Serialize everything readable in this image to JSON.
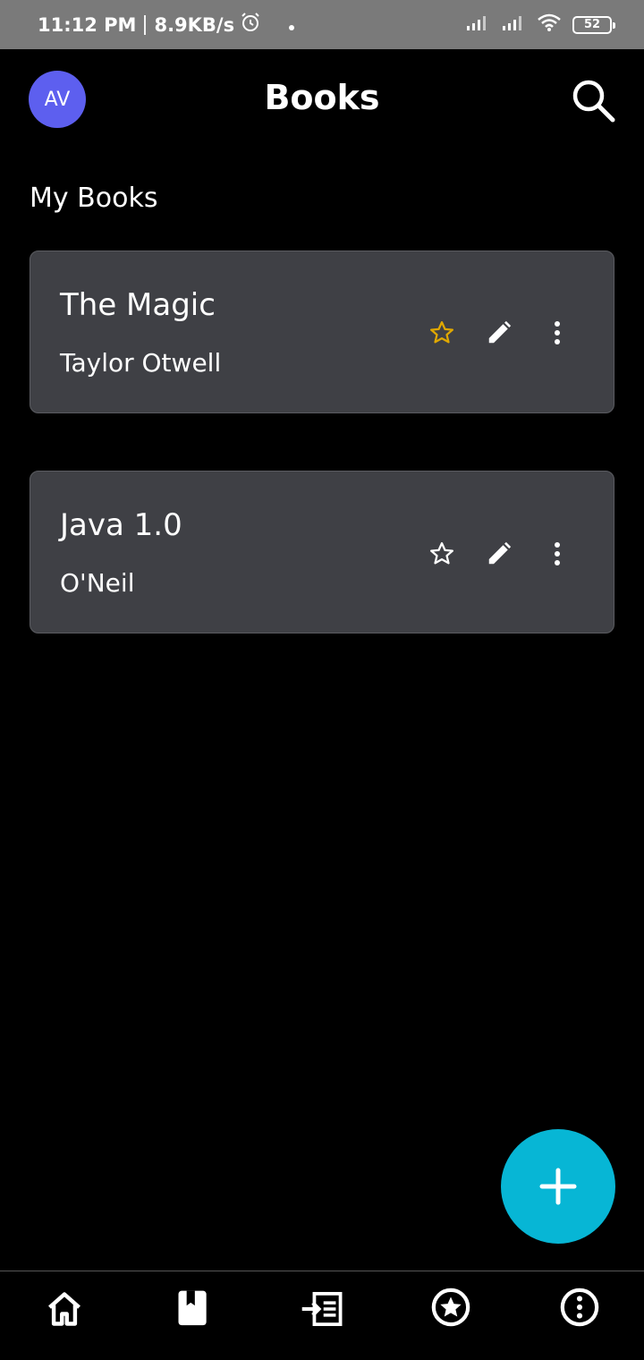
{
  "status_bar": {
    "time": "11:12 PM",
    "speed": "8.9KB/s",
    "battery": "52",
    "icons": [
      "alarm-icon",
      "dot-icon",
      "signal-icon",
      "signal-icon",
      "wifi-icon",
      "battery-icon"
    ]
  },
  "app_bar": {
    "avatar_initials": "AV",
    "title": "Books",
    "search_icon": "search-icon"
  },
  "section": {
    "title": "My Books"
  },
  "books": [
    {
      "title": "The Magic",
      "author": "Taylor Otwell",
      "favorite": true
    },
    {
      "title": "Java 1.0",
      "author": "O'Neil",
      "favorite": false
    }
  ],
  "colors": {
    "avatar": "#5d5fef",
    "card_bg": "#3f4045",
    "favorite_star": "#e0a800",
    "fab": "#07b6d5"
  },
  "fab": {
    "icon": "plus-icon"
  },
  "bottom_nav": {
    "items": [
      "home-icon",
      "book-icon",
      "import-list-icon",
      "star-circle-icon",
      "info-circle-icon"
    ]
  }
}
